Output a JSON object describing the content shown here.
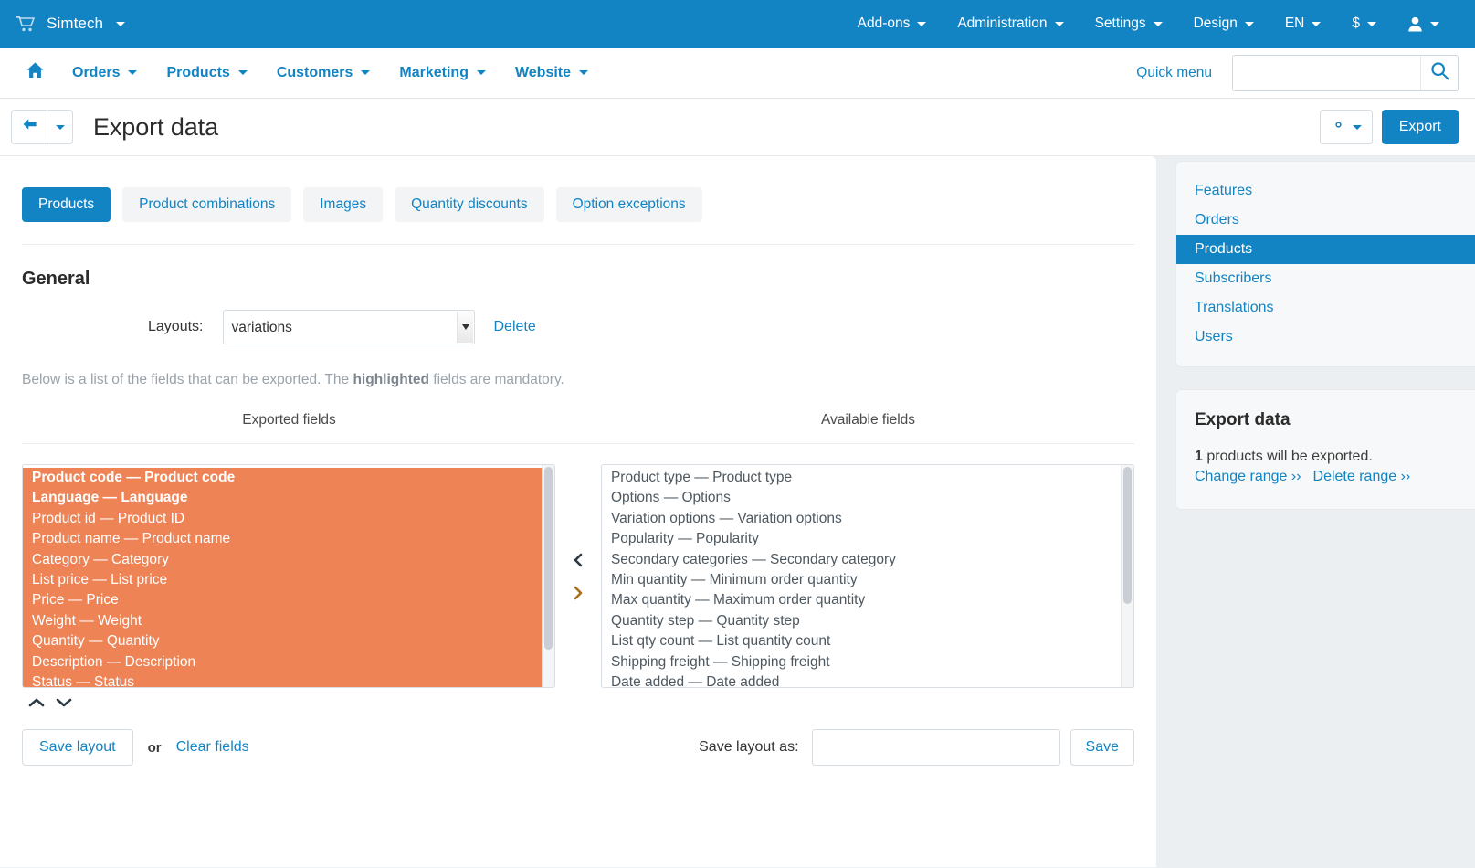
{
  "topbar": {
    "cart_icon": "shopping-cart-icon",
    "brand": "Simtech",
    "menu": [
      {
        "label": "Add-ons",
        "caret": true
      },
      {
        "label": "Administration",
        "caret": true
      },
      {
        "label": "Settings",
        "caret": true
      },
      {
        "label": "Design",
        "caret": true
      },
      {
        "label": "EN",
        "caret": true
      },
      {
        "label": "$",
        "caret": true
      }
    ],
    "user_icon": "user-icon"
  },
  "mainnav": {
    "home_icon": "home-icon",
    "items": [
      {
        "label": "Orders"
      },
      {
        "label": "Products"
      },
      {
        "label": "Customers"
      },
      {
        "label": "Marketing"
      },
      {
        "label": "Website"
      }
    ],
    "quick_menu": "Quick menu",
    "search_value": "",
    "search_placeholder": "",
    "search_icon": "search-icon"
  },
  "titlebar": {
    "back_icon": "arrow-left-icon",
    "title": "Export data",
    "gear_icon": "gear-icon",
    "export_label": "Export"
  },
  "tabs": [
    {
      "label": "Products",
      "active": true
    },
    {
      "label": "Product combinations",
      "active": false
    },
    {
      "label": "Images",
      "active": false
    },
    {
      "label": "Quantity discounts",
      "active": false
    },
    {
      "label": "Option exceptions",
      "active": false
    }
  ],
  "general": {
    "heading": "General",
    "layouts_label": "Layouts:",
    "layout_selected": "variations",
    "layout_options": [
      "variations"
    ],
    "delete_label": "Delete",
    "help_prefix": "Below is a list of the fields that can be exported. The ",
    "help_bold": "highlighted",
    "help_suffix": " fields are mandatory."
  },
  "fields": {
    "exported_header": "Exported fields",
    "available_header": "Available fields",
    "exported": [
      {
        "label": "Product code — Product code",
        "mandatory": true
      },
      {
        "label": "Language — Language",
        "mandatory": true
      },
      {
        "label": "Product id — Product ID",
        "mandatory": false
      },
      {
        "label": "Product name — Product name",
        "mandatory": false
      },
      {
        "label": "Category — Category",
        "mandatory": false
      },
      {
        "label": "List price — List price",
        "mandatory": false
      },
      {
        "label": "Price — Price",
        "mandatory": false
      },
      {
        "label": "Weight — Weight",
        "mandatory": false
      },
      {
        "label": "Quantity — Quantity",
        "mandatory": false
      },
      {
        "label": "Description — Description",
        "mandatory": false
      },
      {
        "label": "Status — Status",
        "mandatory": false
      }
    ],
    "available": [
      "Product type — Product type",
      "Options — Options",
      "Variation options — Variation options",
      "Popularity — Popularity",
      "Secondary categories — Secondary category",
      "Min quantity — Minimum order quantity",
      "Max quantity — Maximum order quantity",
      "Quantity step — Quantity step",
      "List qty count — List quantity count",
      "Shipping freight — Shipping freight",
      "Date added — Date added"
    ],
    "move_left_icon": "chevron-left-icon",
    "move_right_icon": "chevron-right-icon",
    "move_up_icon": "chevron-up-icon",
    "move_down_icon": "chevron-down-icon"
  },
  "bottom": {
    "save_layout": "Save layout",
    "or": "or",
    "clear_fields": "Clear fields",
    "save_layout_as_label": "Save layout as:",
    "save_layout_as_value": "",
    "save_layout_as_placeholder": "",
    "save": "Save"
  },
  "sidebar": {
    "links": [
      {
        "label": "Features",
        "active": false
      },
      {
        "label": "Orders",
        "active": false
      },
      {
        "label": "Products",
        "active": true
      },
      {
        "label": "Subscribers",
        "active": false
      },
      {
        "label": "Translations",
        "active": false
      },
      {
        "label": "Users",
        "active": false
      }
    ],
    "export_card": {
      "heading": "Export data",
      "count": "1",
      "count_text": " products will be exported.",
      "change_range": "Change range ››",
      "delete_range": "Delete range ››"
    }
  },
  "colors": {
    "brand_blue": "#1284c4",
    "selection_orange": "#ee8355",
    "page_bg": "#eceff1",
    "link_blue": "#1284c4"
  }
}
